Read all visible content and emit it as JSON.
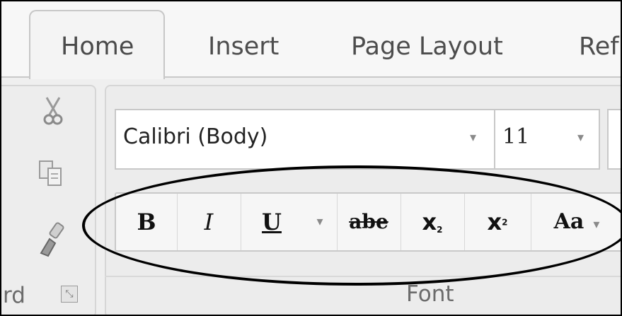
{
  "tabs": [
    {
      "label": "Home",
      "active": true
    },
    {
      "label": "Insert"
    },
    {
      "label": "Page Layout"
    },
    {
      "label": "Ref"
    }
  ],
  "clipboard": {
    "label": "rd",
    "icons": [
      "cut-icon",
      "copy-icon",
      "format-painter-icon"
    ],
    "launcher_glyph": "⤡"
  },
  "font": {
    "group_label": "Font",
    "font_name": "Calibri (Body)",
    "font_size": "11",
    "dropdown_glyph": "▾",
    "buttons": {
      "bold": "B",
      "italic": "I",
      "underline": "U",
      "strikethrough": "abe",
      "subscript_base": "x",
      "subscript_mark": "2",
      "superscript_base": "x",
      "superscript_mark": "2",
      "change_case": "Aa"
    }
  },
  "colors": {
    "tab_text": "#4d4d4d",
    "ribbon_bg": "#efefef",
    "annotation": "#000000"
  }
}
